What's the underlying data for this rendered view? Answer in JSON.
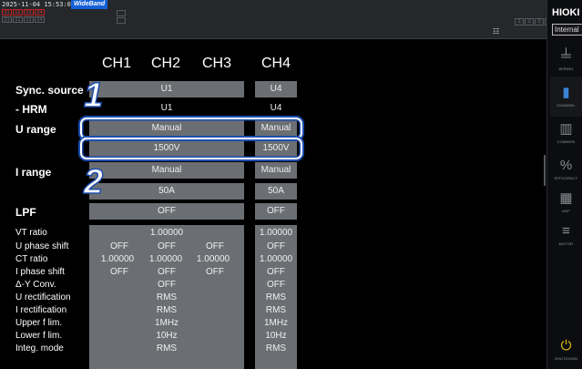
{
  "status": {
    "timestamp": "2025-11-04 15:53:04",
    "mode_badge": "WideBand",
    "channel_indicators": [
      "U1",
      "U2",
      "U3",
      "U4"
    ],
    "current_indicators": [
      "I1",
      "I2",
      "I3",
      "I4"
    ],
    "pages": [
      "1",
      "2",
      "3",
      "4"
    ]
  },
  "brand": "HIOKI",
  "sync_source_menu": "Internal",
  "nav": [
    {
      "label": "WIRING",
      "icon": "wiring-icon"
    },
    {
      "label": "CHANNEL",
      "icon": "channel-icon"
    },
    {
      "label": "COMMON",
      "icon": "common-icon"
    },
    {
      "label": "EFFICIENCY",
      "icon": "efficiency-icon"
    },
    {
      "label": "UDF",
      "icon": "udf-icon"
    },
    {
      "label": "MOTOR",
      "icon": "motor-icon"
    },
    {
      "label": "SHUTDOWN",
      "icon": "shutdown-icon"
    }
  ],
  "channels": [
    "CH1",
    "CH2",
    "CH3",
    "CH4"
  ],
  "settings": {
    "sync_source": {
      "label": "Sync. source",
      "ch123": "U1",
      "ch4": "U4"
    },
    "hrm": {
      "label": "- HRM",
      "ch123": "U1",
      "ch4": "U4"
    },
    "u_range": {
      "label": "U range",
      "mode123": "Manual",
      "mode4": "Manual",
      "value123": "1500V",
      "value4": "1500V"
    },
    "i_range": {
      "label": "I range",
      "mode123": "Manual",
      "mode4": "Manual",
      "value123": "50A",
      "value4": "50A"
    },
    "lpf": {
      "label": "LPF",
      "ch123": "OFF",
      "ch4": "OFF"
    }
  },
  "callouts": [
    "1",
    "2"
  ],
  "table": [
    {
      "label": "VT ratio",
      "center": "1.00000",
      "ch4": "1.00000"
    },
    {
      "label": "U phase shift",
      "ch1": "OFF",
      "ch2": "OFF",
      "ch3": "OFF",
      "ch4": "OFF"
    },
    {
      "label": "CT ratio",
      "ch1": "1.00000",
      "ch2": "1.00000",
      "ch3": "1.00000",
      "ch4": "1.00000"
    },
    {
      "label": "I phase shift",
      "ch1": "OFF",
      "ch2": "OFF",
      "ch3": "OFF",
      "ch4": "OFF"
    },
    {
      "label": "Δ-Y Conv.",
      "center": "OFF",
      "ch4": "OFF"
    },
    {
      "label": "U rectification",
      "center": "RMS",
      "ch4": "RMS"
    },
    {
      "label": "I rectification",
      "center": "RMS",
      "ch4": "RMS"
    },
    {
      "label": "Upper f lim.",
      "center": "1MHz",
      "ch4": "1MHz"
    },
    {
      "label": "Lower f lim.",
      "center": "10Hz",
      "ch4": "10Hz"
    },
    {
      "label": "Integ. mode",
      "center": "RMS",
      "ch4": "RMS"
    }
  ]
}
